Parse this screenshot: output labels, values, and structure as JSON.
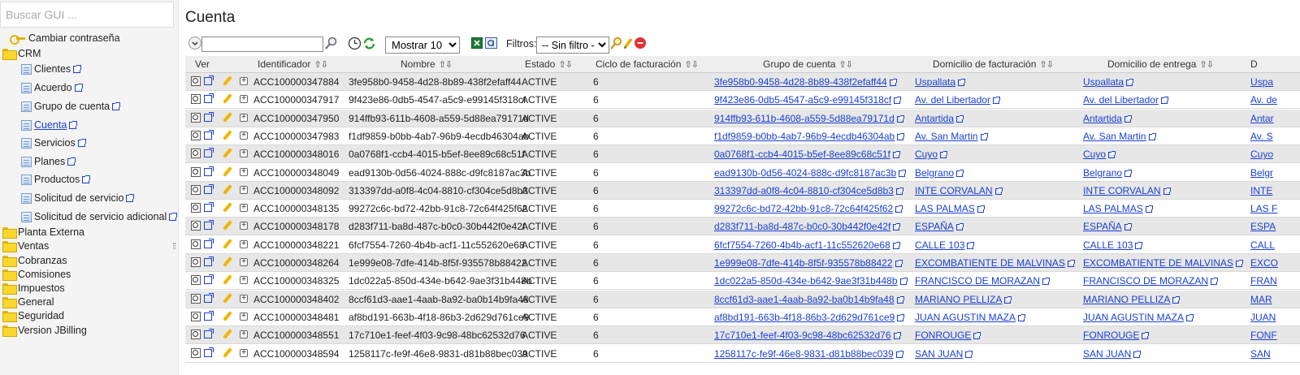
{
  "sidebar": {
    "search_placeholder": "Buscar GUI ...",
    "change_password": "Cambiar contraseña",
    "crm": "CRM",
    "items": [
      "Clientes",
      "Acuerdo",
      "Grupo de cuenta",
      "Cuenta",
      "Servicios",
      "Planes",
      "Productos",
      "Solicitud de servicio",
      "Solicitud de servicio adicional"
    ],
    "folders": [
      "Planta Externa",
      "Ventas",
      "Cobranzas",
      "Comisiones",
      "Impuestos",
      "General",
      "Seguridad",
      "Version JBilling"
    ]
  },
  "main": {
    "title": "Cuenta",
    "toolbar": {
      "show_select": "Mostrar 10",
      "filters_label": "Filtros:",
      "filter_select": "-- Sin filtro --"
    },
    "columns": [
      "Ver",
      "Identificador",
      "Nombre",
      "Estado",
      "Ciclo de facturación",
      "Grupo de cuenta",
      "Domicilio de facturación",
      "Domicilio de entrega",
      "D"
    ],
    "rows": [
      {
        "id": "ACC100000347884",
        "name": "3fe958b0-9458-4d28-8b89-438f2efaff44",
        "state": "ACTIVE",
        "cycle": "6",
        "group": "3fe958b0-9458-4d28-8b89-438f2efaff44",
        "billing": "Uspallata",
        "delivery": "Uspallata",
        "extra": "Uspa"
      },
      {
        "id": "ACC100000347917",
        "name": "9f423e86-0db5-4547-a5c9-e99145f318cf",
        "state": "ACTIVE",
        "cycle": "6",
        "group": "9f423e86-0db5-4547-a5c9-e99145f318cf",
        "billing": "Av. del Libertador",
        "delivery": "Av. del Libertador",
        "extra": "Av. de"
      },
      {
        "id": "ACC100000347950",
        "name": "914ffb93-611b-4608-a559-5d88ea79171d",
        "state": "ACTIVE",
        "cycle": "6",
        "group": "914ffb93-611b-4608-a559-5d88ea79171d",
        "billing": "Antartida",
        "delivery": "Antartida",
        "extra": "Antar"
      },
      {
        "id": "ACC100000347983",
        "name": "f1df9859-b0bb-4ab7-96b9-4ecdb46304ab",
        "state": "ACTIVE",
        "cycle": "6",
        "group": "f1df9859-b0bb-4ab7-96b9-4ecdb46304ab",
        "billing": "Av. San Martin",
        "delivery": "Av. San Martin",
        "extra": "Av. S"
      },
      {
        "id": "ACC100000348016",
        "name": "0a0768f1-ccb4-4015-b5ef-8ee89c68c51f",
        "state": "ACTIVE",
        "cycle": "6",
        "group": "0a0768f1-ccb4-4015-b5ef-8ee89c68c51f",
        "billing": "Cuyo",
        "delivery": "Cuyo",
        "extra": "Cuyo"
      },
      {
        "id": "ACC100000348049",
        "name": "ead9130b-0d56-4024-888c-d9fc8187ac3b",
        "state": "ACTIVE",
        "cycle": "6",
        "group": "ead9130b-0d56-4024-888c-d9fc8187ac3b",
        "billing": "Belgrano",
        "delivery": "Belgrano",
        "extra": "Belgr"
      },
      {
        "id": "ACC100000348092",
        "name": "313397dd-a0f8-4c04-8810-cf304ce5d8b3",
        "state": "ACTIVE",
        "cycle": "6",
        "group": "313397dd-a0f8-4c04-8810-cf304ce5d8b3",
        "billing": "INTE CORVALAN",
        "delivery": "INTE CORVALAN",
        "extra": "INTE"
      },
      {
        "id": "ACC100000348135",
        "name": "99272c6c-bd72-42bb-91c8-72c64f425f62",
        "state": "ACTIVE",
        "cycle": "6",
        "group": "99272c6c-bd72-42bb-91c8-72c64f425f62",
        "billing": "LAS PALMAS",
        "delivery": "LAS PALMAS",
        "extra": "LAS F"
      },
      {
        "id": "ACC100000348178",
        "name": "d283f711-ba8d-487c-b0c0-30b442f0e42f",
        "state": "ACTIVE",
        "cycle": "6",
        "group": "d283f711-ba8d-487c-b0c0-30b442f0e42f",
        "billing": "ESPAÑA",
        "delivery": "ESPAÑA",
        "extra": "ESPA"
      },
      {
        "id": "ACC100000348221",
        "name": "6fcf7554-7260-4b4b-acf1-11c552620e68",
        "state": "ACTIVE",
        "cycle": "6",
        "group": "6fcf7554-7260-4b4b-acf1-11c552620e68",
        "billing": "CALLE 103",
        "delivery": "CALLE 103",
        "extra": "CALL"
      },
      {
        "id": "ACC100000348264",
        "name": "1e999e08-7dfe-414b-8f5f-935578b88422",
        "state": "ACTIVE",
        "cycle": "6",
        "group": "1e999e08-7dfe-414b-8f5f-935578b88422",
        "billing": "EXCOMBATIENTE DE MALVINAS",
        "delivery": "EXCOMBATIENTE DE MALVINAS",
        "extra": "EXCO"
      },
      {
        "id": "ACC100000348325",
        "name": "1dc022a5-850d-434e-b642-9ae3f31b448b",
        "state": "ACTIVE",
        "cycle": "6",
        "group": "1dc022a5-850d-434e-b642-9ae3f31b448b",
        "billing": "FRANCISCO DE MORAZAN",
        "delivery": "FRANCISCO DE MORAZAN",
        "extra": "FRAN"
      },
      {
        "id": "ACC100000348402",
        "name": "8ccf61d3-aae1-4aab-8a92-ba0b14b9fa48",
        "state": "ACTIVE",
        "cycle": "6",
        "group": "8ccf61d3-aae1-4aab-8a92-ba0b14b9fa48",
        "billing": "MARIANO PELLIZA",
        "delivery": "MARIANO PELLIZA",
        "extra": "MAR"
      },
      {
        "id": "ACC100000348481",
        "name": "af8bd191-663b-4f18-86b3-2d629d761ce9",
        "state": "ACTIVE",
        "cycle": "6",
        "group": "af8bd191-663b-4f18-86b3-2d629d761ce9",
        "billing": "JUAN AGUSTIN MAZA",
        "delivery": "JUAN AGUSTIN MAZA",
        "extra": "JUAN"
      },
      {
        "id": "ACC100000348551",
        "name": "17c710e1-feef-4f03-9c98-48bc62532d76",
        "state": "ACTIVE",
        "cycle": "6",
        "group": "17c710e1-feef-4f03-9c98-48bc62532d76",
        "billing": "FONROUGE",
        "delivery": "FONROUGE",
        "extra": "FONF"
      },
      {
        "id": "ACC100000348594",
        "name": "1258117c-fe9f-46e8-9831-d81b88bec039",
        "state": "ACTIVE",
        "cycle": "6",
        "group": "1258117c-fe9f-46e8-9831-d81b88bec039",
        "billing": "SAN JUAN",
        "delivery": "SAN JUAN",
        "extra": "SAN"
      }
    ]
  }
}
